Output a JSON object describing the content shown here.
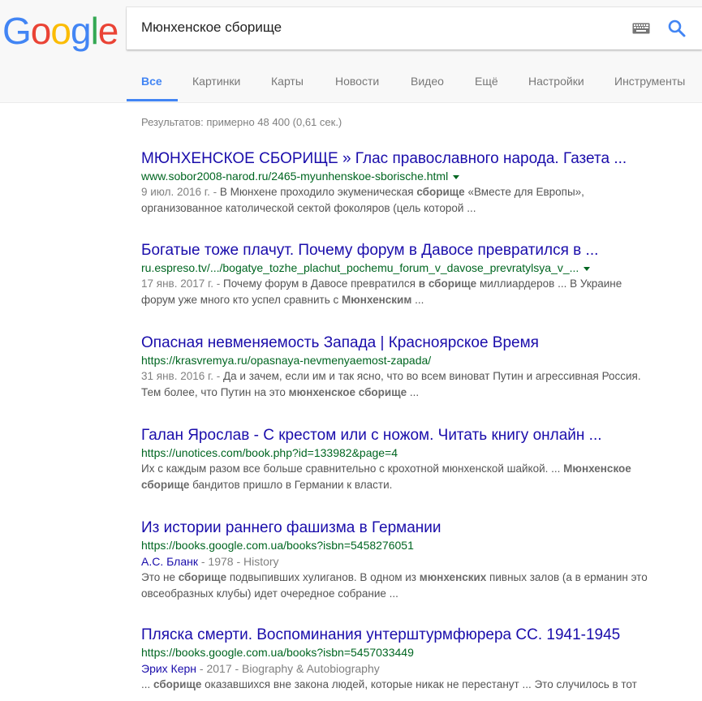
{
  "logo": {
    "letters": [
      "G",
      "o",
      "o",
      "g",
      "l",
      "e"
    ],
    "colors": [
      "#4285f4",
      "#ea4335",
      "#fbbc05",
      "#4285f4",
      "#34a853",
      "#ea4335"
    ]
  },
  "search": {
    "query": "Мюнхенское сборище"
  },
  "tabs": [
    {
      "label": "Все",
      "active": true
    },
    {
      "label": "Картинки"
    },
    {
      "label": "Карты"
    },
    {
      "label": "Новости"
    },
    {
      "label": "Видео"
    },
    {
      "label": "Ещё"
    },
    {
      "label": "Настройки"
    },
    {
      "label": "Инструменты"
    }
  ],
  "stats": "Результатов: примерно 48 400 (0,61 сек.)",
  "results": [
    {
      "title": "МЮНХЕНСКОЕ СБОРИЩЕ » Глас православного народа. Газета ...",
      "url": "www.sobor2008-narod.ru/2465-myunhenskoe-sborische.html",
      "has_caret": true,
      "snippet1": [
        {
          "t": "9 июл. 2016 г. - ",
          "d": true
        },
        {
          "t": "В Мюнхене проходило экуменическая "
        },
        {
          "t": "сборище",
          "b": true
        },
        {
          "t": " «Вместе для Европы»,"
        }
      ],
      "snippet2": [
        {
          "t": "организованное католической сектой фоколяров (цель которой ..."
        }
      ]
    },
    {
      "title": "Богатые тоже плачут. Почему форум в Давосе превратился в ...",
      "url": "ru.espreso.tv/.../bogatye_tozhe_plachut_pochemu_forum_v_davose_prevratylsya_v_...",
      "has_caret": true,
      "snippet1": [
        {
          "t": "17 янв. 2017 г. - ",
          "d": true
        },
        {
          "t": "Почему форум в Давосе превратился "
        },
        {
          "t": "в",
          "b": true
        },
        {
          "t": " "
        },
        {
          "t": "сборище",
          "b": true
        },
        {
          "t": " миллиардеров ... В Украине"
        }
      ],
      "snippet2": [
        {
          "t": "форум уже много кто успел сравнить с "
        },
        {
          "t": "Мюнхенским",
          "b": true
        },
        {
          "t": " ..."
        }
      ]
    },
    {
      "title": "Опасная невменяемость Запада | Красноярское Время",
      "url": "https://krasvremya.ru/opasnaya-nevmenyaemost-zapada/",
      "has_caret": false,
      "snippet1": [
        {
          "t": "31 янв. 2016 г. - ",
          "d": true
        },
        {
          "t": "Да и зачем, если им и так ясно, что во всем виноват Путин и агрессивная Россия."
        }
      ],
      "snippet2": [
        {
          "t": "Тем более, что Путин на это "
        },
        {
          "t": "мюнхенское сборище",
          "b": true
        },
        {
          "t": " ..."
        }
      ]
    },
    {
      "title": "Галан Ярослав - С крестом или с ножом. Читать книгу онлайн ...",
      "url": "https://unotices.com/book.php?id=133982&page=4",
      "has_caret": false,
      "snippet1": [
        {
          "t": "Их с каждым разом все больше сравнительно с крохотной мюнхенской шайкой. ... "
        },
        {
          "t": "Мюнхенское",
          "b": true
        }
      ],
      "snippet2": [
        {
          "t": "сборище",
          "b": true
        },
        {
          "t": " бандитов пришло в Германии к власти."
        }
      ]
    },
    {
      "title": "Из истории раннего фашизма в Германии",
      "url": "https://books.google.com.ua/books?isbn=5458276051",
      "has_caret": false,
      "meta_author": "А.С. Бланк",
      "meta_rest": " - 1978 - History",
      "snippet1": [
        {
          "t": "Это не "
        },
        {
          "t": "сборище",
          "b": true
        },
        {
          "t": " подвыпивших хулиганов. В одном из "
        },
        {
          "t": "мюнхенских",
          "b": true
        },
        {
          "t": " пивных залов (а в ерманин это"
        }
      ],
      "snippet2": [
        {
          "t": "овсеобразных клубы) идет очередное собрание ..."
        }
      ]
    },
    {
      "title": "Пляска смерти. Воспоминания унтерштурмфюрера СС. 1941-1945",
      "url": "https://books.google.com.ua/books?isbn=5457033449",
      "has_caret": false,
      "meta_author": "Эрих Керн",
      "meta_rest": " - 2017 - Biography & Autobiography",
      "snippet1": [
        {
          "t": "... "
        },
        {
          "t": "сборище",
          "b": true
        },
        {
          "t": " оказавшихся вне закона людей, которые никак не перестанут ... Это случилось в тот"
        }
      ],
      "snippet2": []
    }
  ]
}
